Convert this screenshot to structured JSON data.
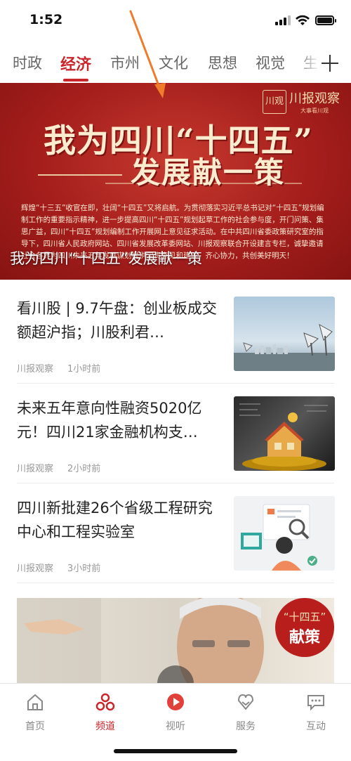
{
  "status": {
    "time": "1:52"
  },
  "tabs": [
    {
      "label": "时政"
    },
    {
      "label": "经济"
    },
    {
      "label": "市州"
    },
    {
      "label": "文化"
    },
    {
      "label": "思想"
    },
    {
      "label": "视觉"
    },
    {
      "label": "生"
    }
  ],
  "active_tab_index": 1,
  "banner": {
    "brand": "川报观察",
    "brand_logo": "川观",
    "brand_sub": "大事看川观",
    "title_line1": "我为四川“十四五”",
    "title_line2": "发展献一策",
    "body": "辉煌“十三五”收官在即，壮阔“十四五”又将启航。为贯彻落实习近平总书记对“十四五”规划编制工作的重要指示精神，进一步提高四川“十四五”规划起草工作的社会参与度，开门问策、集思广益，四川“十四五”规划编制工作开展网上意见征求活动。在中共四川省委政策研究室的指导下，四川省人民政府网站、四川省发展改革委网站、川报观察联合开设建言专栏，诚挚邀请社会各界为四川未来五年发展谋划提供宝贵意见和建议，齐心协力，共创美好明天！",
    "caption": "我为四川“十四五”发展献一策"
  },
  "news": [
    {
      "title": "看川股 | 9.7午盘：创业板成交额超沪指；川股利君…",
      "source": "川报观察",
      "time": "1小时前",
      "thumb": "city-antenna-photo"
    },
    {
      "title": "未来五年意向性融资5020亿元！四川21家金融机构支…",
      "source": "川报观察",
      "time": "2小时前",
      "thumb": "house-coins-photo"
    },
    {
      "title": "四川新批建26个省级工程研究中心和工程实验室",
      "source": "川报观察",
      "time": "3小时前",
      "thumb": "research-illustration"
    }
  ],
  "video_card": {
    "badge_top": "“十四五”",
    "badge_bottom": "献策"
  },
  "bottom_nav": [
    {
      "label": "首页",
      "icon": "home-icon"
    },
    {
      "label": "频道",
      "icon": "channels-icon"
    },
    {
      "label": "视听",
      "icon": "play-icon"
    },
    {
      "label": "服务",
      "icon": "service-icon"
    },
    {
      "label": "互动",
      "icon": "chat-icon"
    }
  ],
  "active_nav_index": 1,
  "colors": {
    "accent": "#c9262b",
    "annotation": "#f07b2b"
  }
}
